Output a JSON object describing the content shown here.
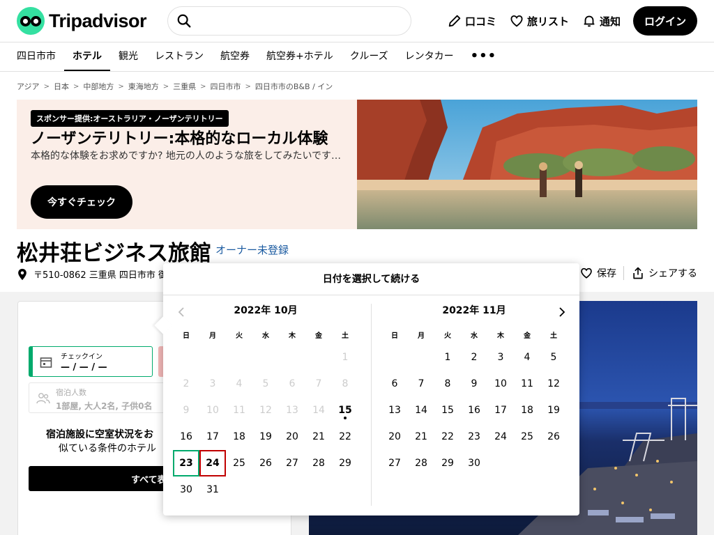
{
  "header": {
    "logo_text": "Tripadvisor",
    "search_placeholder": "",
    "review_label": "口コミ",
    "trips_label": "旅リスト",
    "alerts_label": "通知",
    "login_label": "ログイン"
  },
  "nav": {
    "items": [
      "四日市市",
      "ホテル",
      "観光",
      "レストラン",
      "航空券",
      "航空券+ホテル",
      "クルーズ",
      "レンタカー"
    ],
    "more": "•••"
  },
  "breadcrumb": [
    "アジア",
    "日本",
    "中部地方",
    "東海地方",
    "三重県",
    "四日市市",
    "四日市市のB&B / イン"
  ],
  "banner": {
    "sponsor": "スポンサー提供:オーストラリア・ノーザンテリトリー",
    "title": "ノーザンテリトリー:本格的なローカル体験",
    "subtitle": "本格的な体験をお求めですか? 地元の人のような旅をしてみたいですか?",
    "cta": "今すぐチェック"
  },
  "hotel": {
    "name": "松井荘ビジネス旅館",
    "owner_link": "オーナー未登録",
    "address": "〒510-0862 三重県 四日市市 御",
    "save_label": "保存",
    "share_label": "シェアする"
  },
  "booking": {
    "checkin_label": "チェックイン",
    "checkin_value": "— / — / —",
    "guests_label": "宿泊人数",
    "guests_value": "1部屋, 大人2名, 子供0名",
    "availability_msg": "宿泊施設に空室状況をお",
    "availability_sub": "似ている条件のホテル",
    "show_all": "すべて表"
  },
  "calendar": {
    "header": "日付を選択して続ける",
    "weekdays": [
      "日",
      "月",
      "火",
      "水",
      "木",
      "金",
      "土"
    ],
    "months": [
      {
        "title": "2022年 10月",
        "offset": 6,
        "days": 31,
        "past_until": 14,
        "today": 15,
        "checkin": 23,
        "checkout": 24
      },
      {
        "title": "2022年 11月",
        "offset": 2,
        "days": 30
      }
    ]
  },
  "colors": {
    "brand_green": "#34e0a1",
    "checkin_border": "#00aa6c",
    "checkout_border": "#c00000",
    "link_blue": "#1a5aa0",
    "banner_bg": "#fbeee8"
  }
}
